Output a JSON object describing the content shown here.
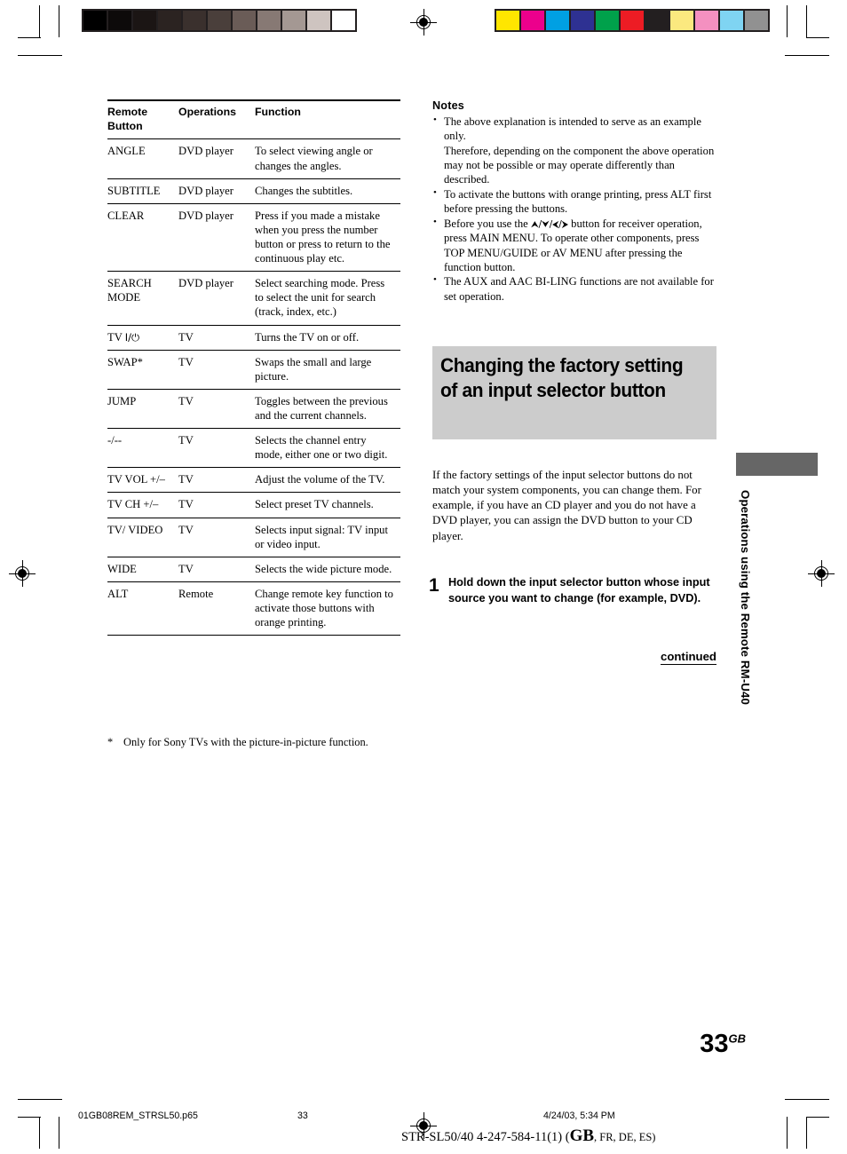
{
  "page": {
    "number": "33",
    "number_suffix": "GB"
  },
  "calibration": {
    "gray_wedge": [
      "#000000",
      "#0d0a0a",
      "#1b1514",
      "#2b2321",
      "#3a302d",
      "#4a3f3b",
      "#6a5c57",
      "#877974",
      "#a49893",
      "#cec4c0",
      "#ffffff"
    ],
    "color_bars": [
      "#ffe600",
      "#ec008c",
      "#00a0e3",
      "#2e3192",
      "#00a14b",
      "#ed1c24",
      "#231f20",
      "#fbe97f",
      "#f490c0",
      "#7fd4f2",
      "#919191"
    ]
  },
  "table": {
    "columns": [
      "Remote Button",
      "Operations",
      "Function"
    ],
    "column_html": [
      "Remote<br>Button",
      "Operations",
      "Function"
    ],
    "rows": [
      {
        "button": "ANGLE",
        "operations": "DVD player",
        "function": "To select viewing angle or changes the angles."
      },
      {
        "button": "SUBTITLE",
        "operations": "DVD player",
        "function": "Changes the subtitles."
      },
      {
        "button": "CLEAR",
        "operations": "DVD player",
        "function": "Press if you made a mistake when you press the number button or press to return to the continuous play etc."
      },
      {
        "button": "SEARCH MODE",
        "operations": "DVD player",
        "function": "Select searching mode. Press to select the unit for search (track, index, etc.)"
      },
      {
        "button": "TV I/⏻",
        "operations": "TV",
        "function": "Turns the TV on or off."
      },
      {
        "button": "SWAP*",
        "operations": "TV",
        "function": "Swaps the small and large picture."
      },
      {
        "button": "JUMP",
        "operations": "TV",
        "function": "Toggles between the previous and the current channels."
      },
      {
        "button": "-/--",
        "operations": "TV",
        "function": "Selects the channel entry mode, either one or two digit."
      },
      {
        "button": "TV VOL +/–",
        "operations": "TV",
        "function": "Adjust the volume of the TV."
      },
      {
        "button": "TV CH +/–",
        "operations": "TV",
        "function": "Select preset TV channels."
      },
      {
        "button": "TV/ VIDEO",
        "operations": "TV",
        "function": "Selects input signal: TV input or video input."
      },
      {
        "button": "WIDE",
        "operations": "TV",
        "function": "Selects the wide picture mode."
      },
      {
        "button": "ALT",
        "operations": "Remote",
        "function": "Change remote key function to activate those buttons with orange printing."
      }
    ],
    "footnote_marker": "*",
    "footnote_text": "Only for Sony TVs with the picture-in-picture function."
  },
  "notes": {
    "heading": "Notes",
    "items": [
      {
        "text": "The above explanation is intended to serve as an example only.",
        "continuation": "Therefore, depending on the component the above operation may not be possible or may operate differently than described."
      },
      {
        "text": "To activate the buttons with orange printing, press ALT first before pressing the buttons."
      },
      {
        "text_before": "Before you use the ",
        "arrows": "⮝/⮟/⮜/⮞",
        "text_after": " button for receiver operation, press MAIN MENU. To operate other components, press TOP MENU/GUIDE or AV MENU after pressing the function button."
      },
      {
        "text": "The AUX and AAC BI-LING functions are not available for set operation."
      }
    ]
  },
  "section": {
    "heading": "Changing the factory setting of an input selector button",
    "heading_bg": "#cccccc",
    "intro": "If the factory settings of the input selector buttons do not match your system components, you can change them. For example, if you have an CD player and you do not have a DVD player, you can assign the DVD button to your CD player.",
    "step_number": "1",
    "step_text": "Hold down the input selector button whose input source you want to change (for example, DVD).",
    "continued_label": "continued"
  },
  "side_tab": {
    "label": "Operations using the Remote RM-U40",
    "block_color": "#666666"
  },
  "footer": {
    "filename": "01GB08REM_STRSL50.p65",
    "page": "33",
    "datestamp": "4/24/03, 5:34 PM",
    "model_prefix": "STR-SL50/40   4-247-584-11(1) (",
    "model_gb": "GB",
    "model_suffix": ", FR, DE, ES)"
  }
}
